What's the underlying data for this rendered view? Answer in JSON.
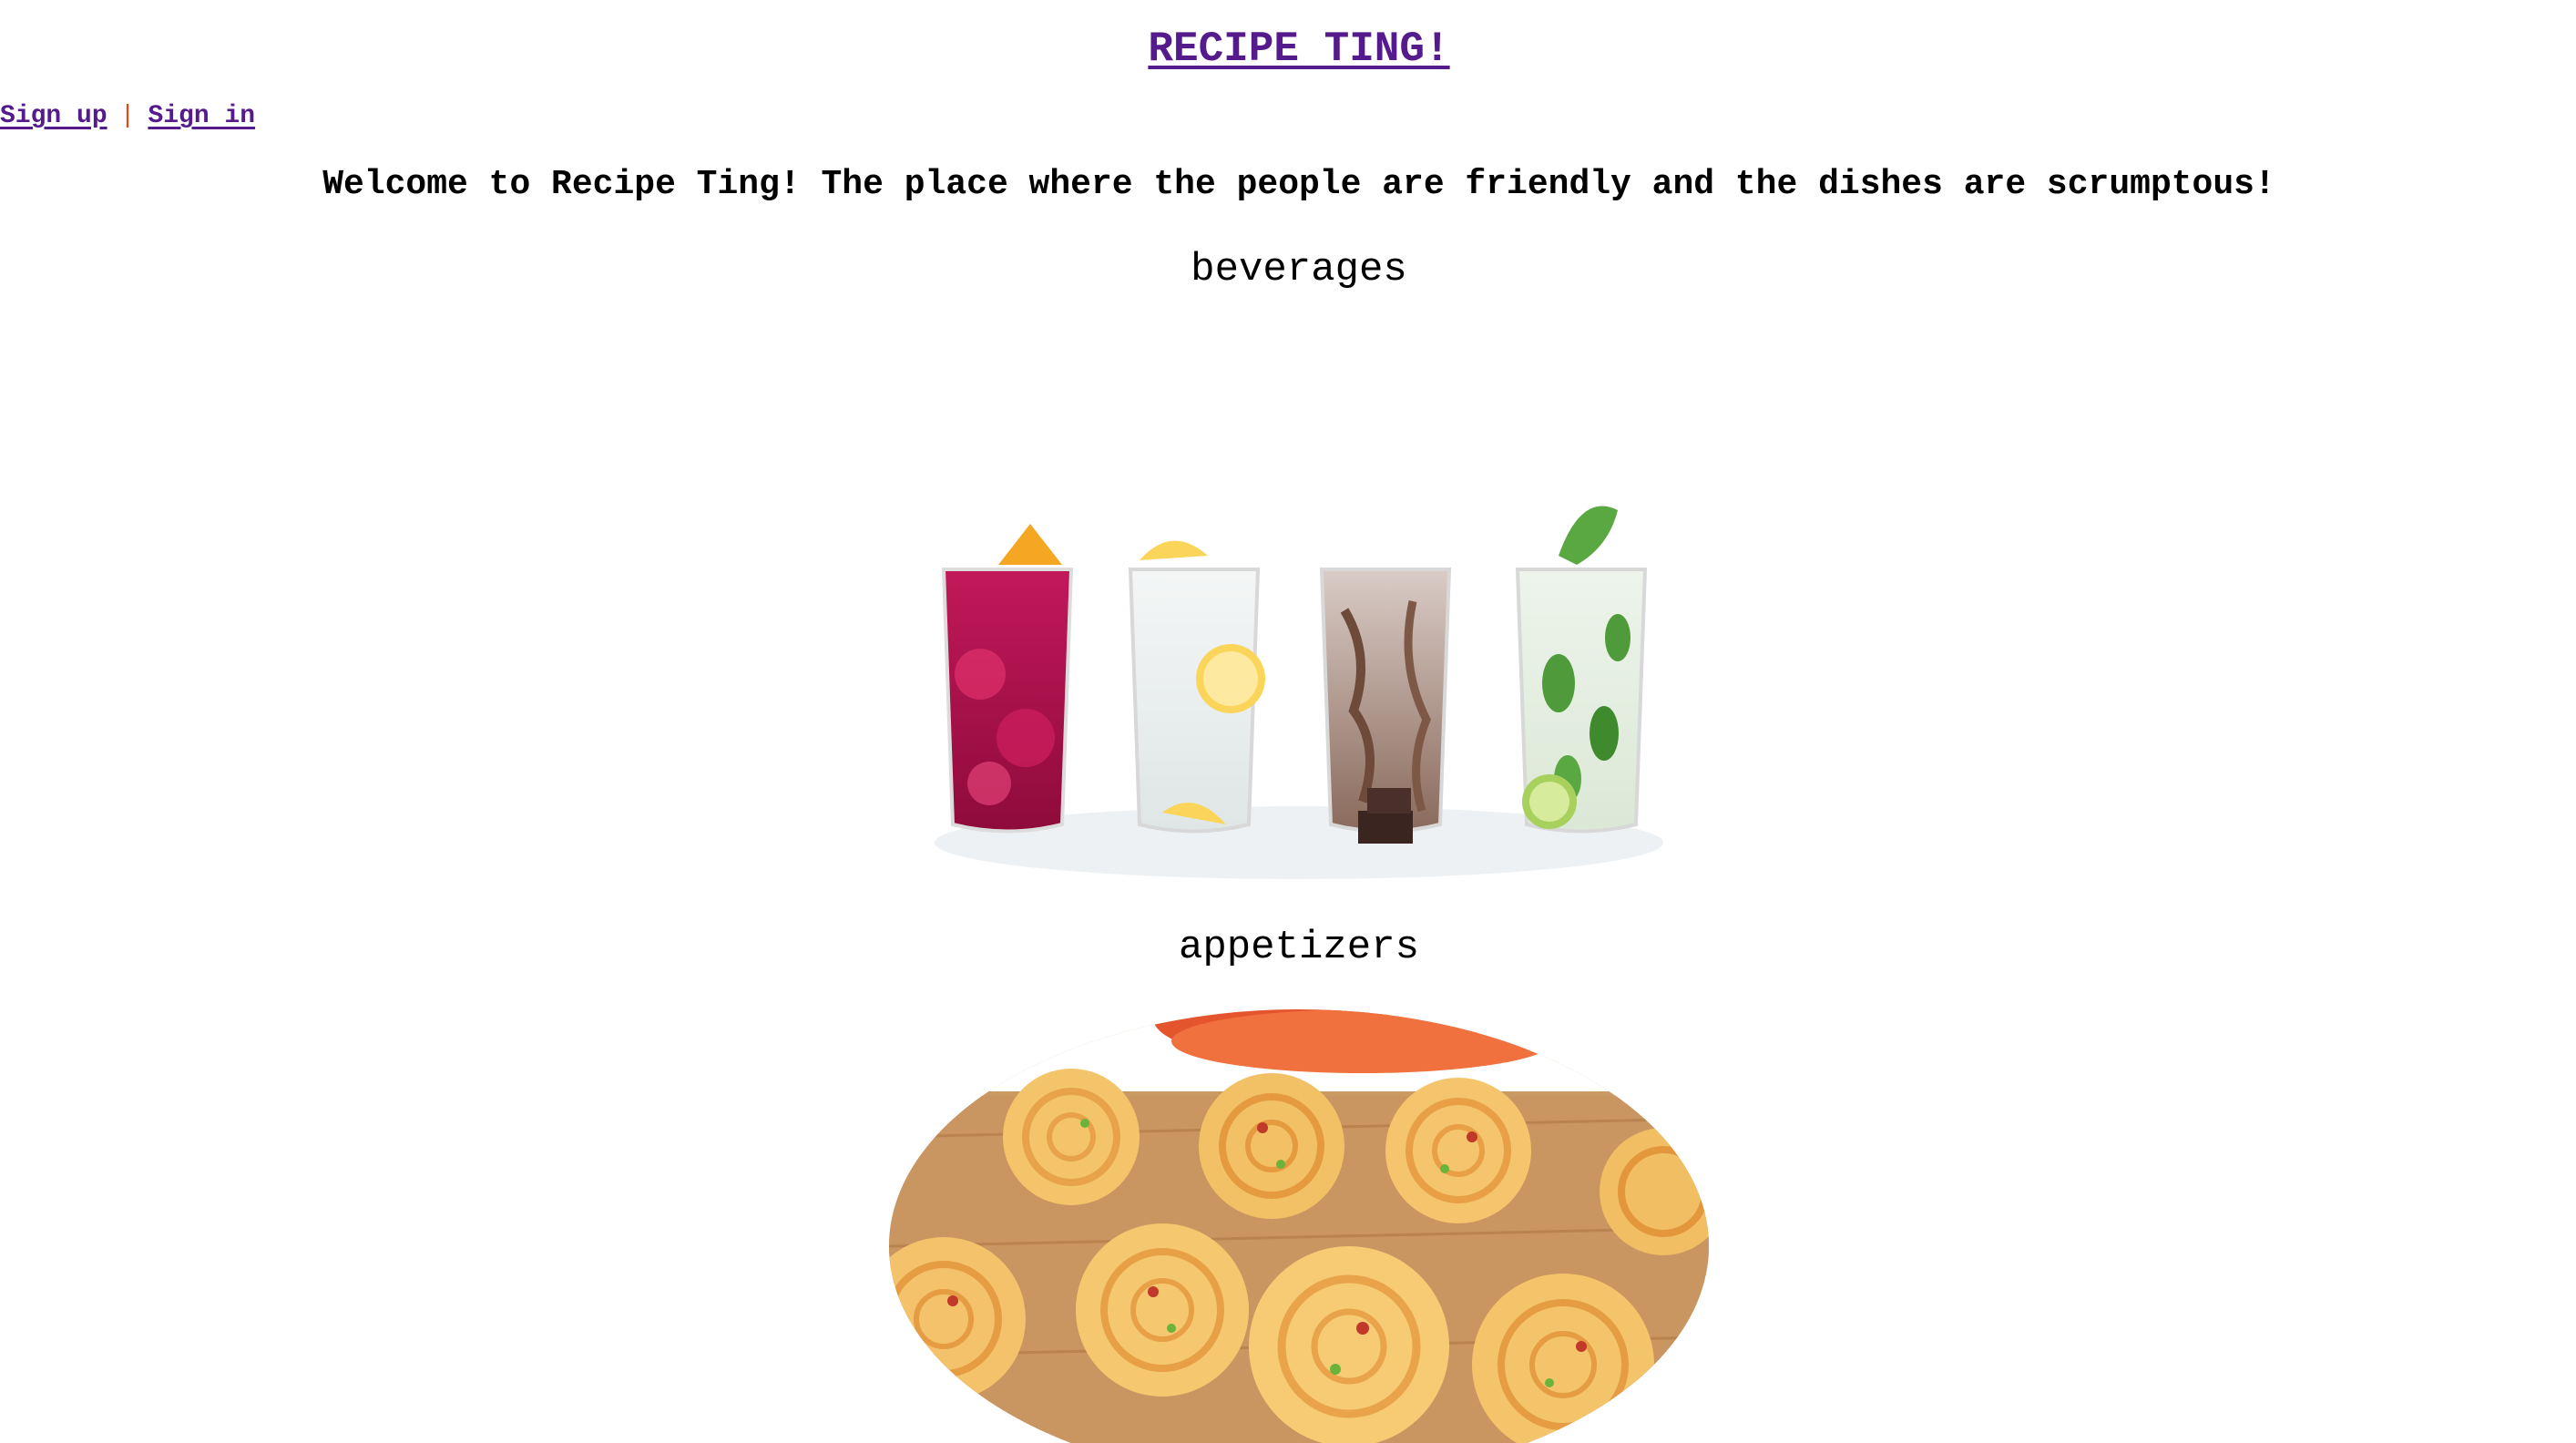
{
  "header": {
    "title": "RECIPE TING!"
  },
  "auth": {
    "sign_up": "Sign up",
    "separator": "|",
    "sign_in": "Sign in"
  },
  "welcome": {
    "text": "Welcome to Recipe Ting! The place where the people are friendly and the dishes are scrumptous!"
  },
  "categories": [
    {
      "name": "beverages",
      "icon": "beverages-photo"
    },
    {
      "name": "appetizers",
      "icon": "appetizers-photo"
    }
  ],
  "colors": {
    "link": "#551a8b",
    "separator": "#e04a1a",
    "text": "#000000",
    "background": "#ffffff"
  }
}
